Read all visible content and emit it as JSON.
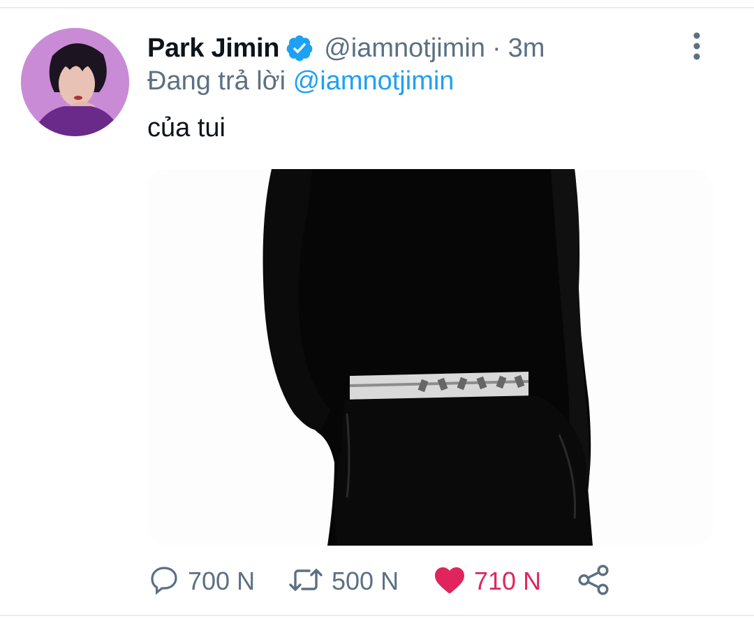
{
  "tweet": {
    "display_name": "Park Jimin",
    "verified": true,
    "handle": "@iamnotjimin",
    "separator": "·",
    "time": "3m",
    "reply_prefix": "Đang trả lời",
    "reply_to": "@iamnotjimin",
    "text": "của tui",
    "media_description": "silhouette photo of a person in black outfit with patterned waistband"
  },
  "actions": {
    "reply_count": "700 N",
    "retweet_count": "500 N",
    "like_count": "710 N",
    "liked": true
  },
  "icons": {
    "verified": "verified-badge-icon",
    "menu": "more-vertical-icon",
    "reply": "comment-icon",
    "retweet": "retweet-icon",
    "like": "heart-icon",
    "share": "share-icon"
  },
  "colors": {
    "accent": "#1da1f2",
    "like": "#e0245e",
    "secondary_text": "#5b7083",
    "avatar_bg": "#c98bd6"
  }
}
